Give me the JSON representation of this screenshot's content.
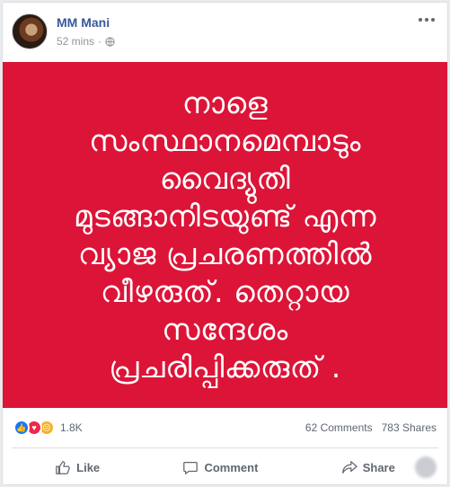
{
  "post": {
    "author": "MM Mani",
    "time": "52 mins",
    "image_lines": [
      "നാളെ",
      "സംസ്ഥാനമെമ്പാടും",
      "വൈദ്യുതി",
      "മുടങ്ങാനിടയുണ്ട് എന്ന",
      "വ്യാജ പ്രചരണത്തിൽ",
      "വീഴരുത്. തെറ്റായ",
      "സന്ദേശം",
      "പ്രചരിപ്പിക്കരുത് ."
    ],
    "image_bg": "#dc1438"
  },
  "stats": {
    "reactions_count": "1.8K",
    "comments": "62 Comments",
    "shares": "783 Shares"
  },
  "actions": {
    "like": "Like",
    "comment": "Comment",
    "share": "Share"
  },
  "colors": {
    "name_blue": "#385898",
    "like_blue": "#1877f2",
    "love_red": "#f0284a",
    "sad_yellow": "#f7b125"
  }
}
